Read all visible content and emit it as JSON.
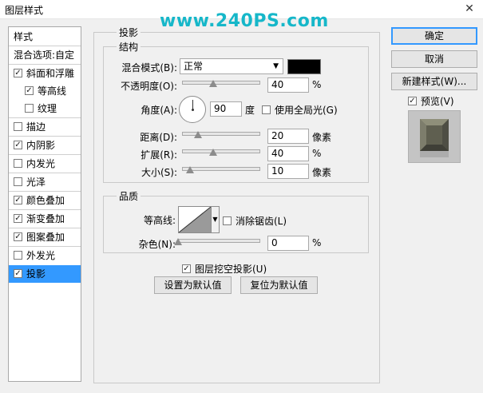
{
  "window": {
    "title": "图层样式",
    "close_label": "✕"
  },
  "watermark": "www.240PS.com",
  "sidebar": {
    "items": [
      {
        "label": "样式",
        "has_checkbox": false,
        "checked": false
      },
      {
        "label": "混合选项:自定",
        "has_checkbox": false,
        "checked": false
      },
      {
        "label": "斜面和浮雕",
        "has_checkbox": true,
        "checked": true
      },
      {
        "label": "等高线",
        "has_checkbox": true,
        "checked": true
      },
      {
        "label": "纹理",
        "has_checkbox": true,
        "checked": false
      },
      {
        "label": "描边",
        "has_checkbox": true,
        "checked": false
      },
      {
        "label": "内阴影",
        "has_checkbox": true,
        "checked": true
      },
      {
        "label": "内发光",
        "has_checkbox": true,
        "checked": false
      },
      {
        "label": "光泽",
        "has_checkbox": true,
        "checked": false
      },
      {
        "label": "颜色叠加",
        "has_checkbox": true,
        "checked": true
      },
      {
        "label": "渐变叠加",
        "has_checkbox": true,
        "checked": true
      },
      {
        "label": "图案叠加",
        "has_checkbox": true,
        "checked": true
      },
      {
        "label": "外发光",
        "has_checkbox": true,
        "checked": false
      },
      {
        "label": "投影",
        "has_checkbox": true,
        "checked": true
      }
    ]
  },
  "shadow": {
    "section_title": "投影",
    "structure": {
      "title": "结构",
      "blend_mode_label": "混合模式(B):",
      "blend_mode_value": "正常",
      "shadow_color": "#000000",
      "opacity_label": "不透明度(O):",
      "opacity_value": "40",
      "opacity_unit": "%",
      "angle_label": "角度(A):",
      "angle_value": "90",
      "angle_unit": "度",
      "global_light_label": "使用全局光(G)",
      "global_light_checked": false,
      "distance_label": "距离(D):",
      "distance_value": "20",
      "distance_unit": "像素",
      "spread_label": "扩展(R):",
      "spread_value": "40",
      "spread_unit": "%",
      "size_label": "大小(S):",
      "size_value": "10",
      "size_unit": "像素"
    },
    "quality": {
      "title": "品质",
      "contour_label": "等高线:",
      "antialias_label": "消除锯齿(L)",
      "antialias_checked": false,
      "noise_label": "杂色(N):",
      "noise_value": "0",
      "noise_unit": "%"
    },
    "knockout_label": "图层挖空投影(U)",
    "knockout_checked": true,
    "make_default_label": "设置为默认值",
    "reset_default_label": "复位为默认值"
  },
  "actions": {
    "ok_label": "确定",
    "cancel_label": "取消",
    "new_style_label": "新建样式(W)...",
    "preview_label": "预览(V)",
    "preview_checked": true
  },
  "sliders": {
    "opacity": 40,
    "distance": 20,
    "spread": 40,
    "size": 10,
    "noise": 0
  }
}
